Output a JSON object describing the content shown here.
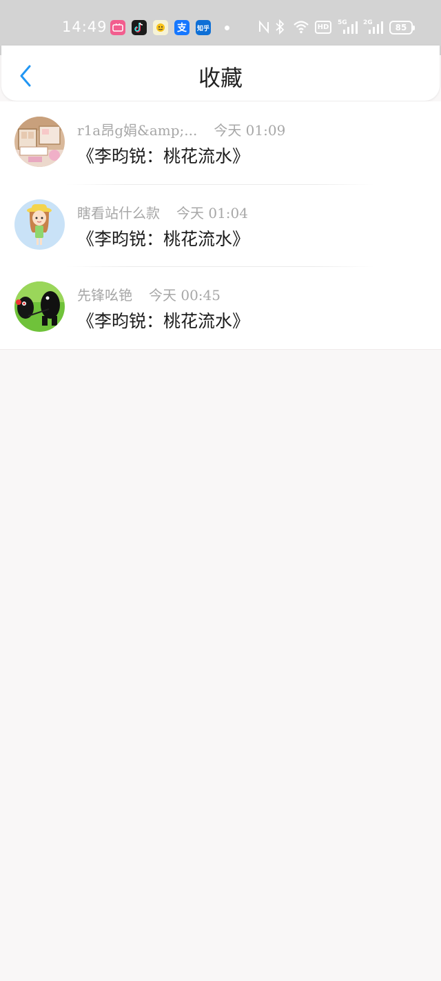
{
  "status_bar": {
    "time": "14:49",
    "app_icons": [
      {
        "name": "bilibili-comic-icon",
        "color": "#f25d8e",
        "glyph": "▭"
      },
      {
        "name": "tiktok-icon",
        "color": "#1b1b1b",
        "glyph": "♪"
      },
      {
        "name": "emoji-app-icon",
        "color": "#f6f3d6",
        "glyph": "☺"
      },
      {
        "name": "alipay-icon",
        "color": "#1677ff",
        "glyph": "支"
      },
      {
        "name": "zhihu-icon",
        "color": "#0d6fd6",
        "glyph": "知乎"
      }
    ],
    "signal_5g_label": "5G",
    "signal_2g_label": "2G",
    "hd_label": "HD",
    "battery_level": "85"
  },
  "header": {
    "title": "收藏",
    "accent_color": "#2196f3"
  },
  "favorites": [
    {
      "user": "r1a昂g娟&amp;...",
      "time": "今天 01:09",
      "title": "《李昀锐：桃花流水》",
      "avatar": "room-photo"
    },
    {
      "user": "瞎看站什么款",
      "time": "今天 01:04",
      "title": "《李昀锐：桃花流水》",
      "avatar": "cartoon-girl"
    },
    {
      "user": "先锋吆铯",
      "time": "今天 00:45",
      "title": "《李昀锐：桃花流水》",
      "avatar": "black-figures"
    }
  ]
}
